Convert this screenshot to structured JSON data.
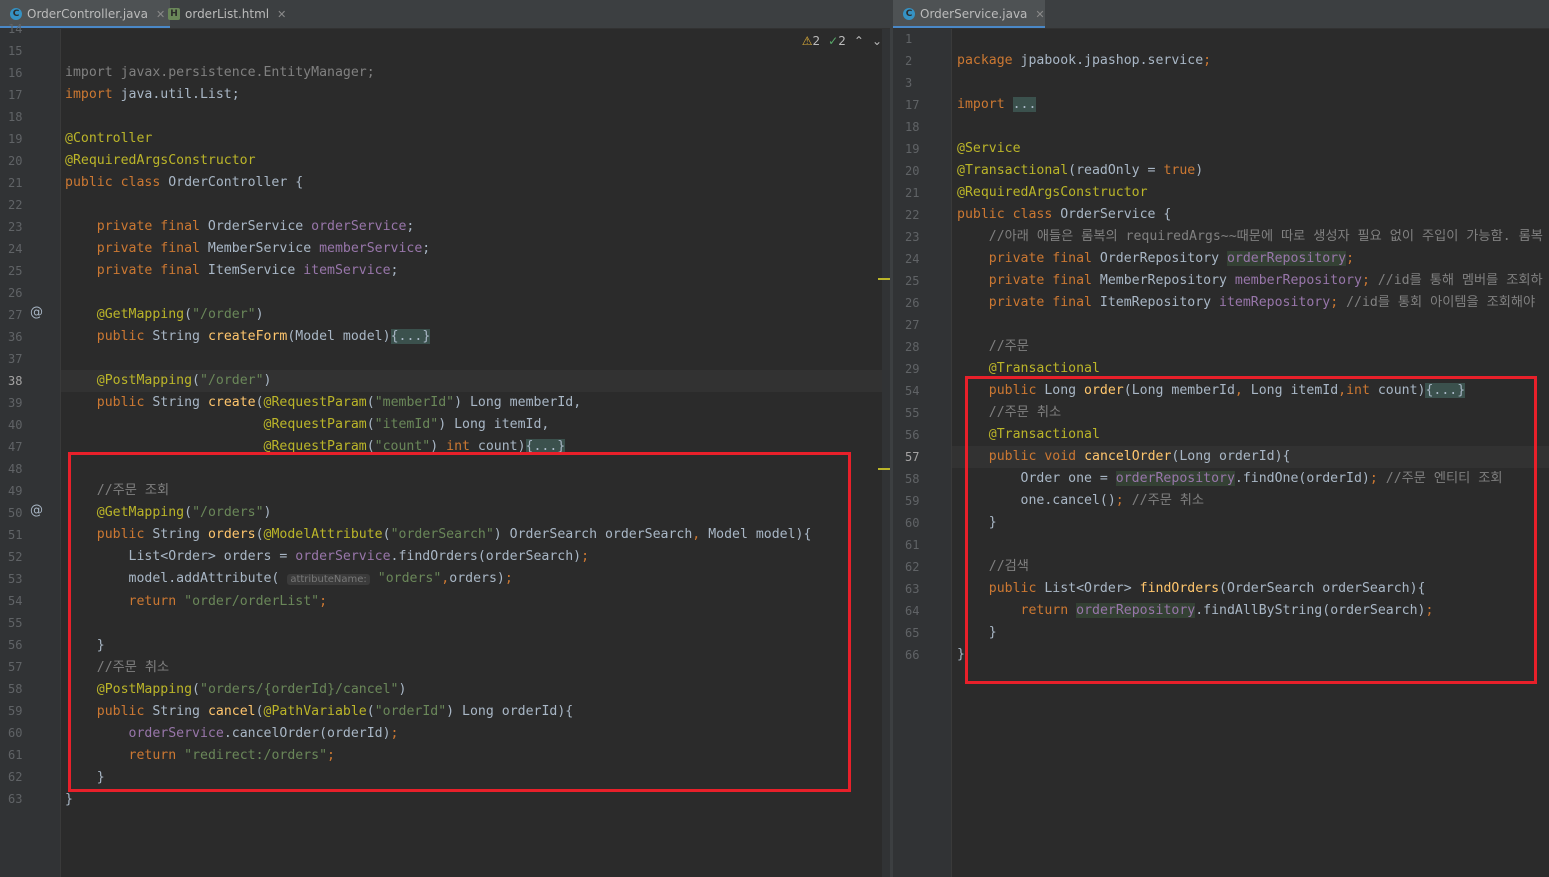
{
  "left_tabs": [
    {
      "label": "OrderController.java",
      "icon": "java-class-icon",
      "active": true
    },
    {
      "label": "orderList.html",
      "icon": "html-file-icon",
      "active": false
    }
  ],
  "right_tabs": [
    {
      "label": "OrderService.java",
      "icon": "java-class-icon",
      "active": true
    }
  ],
  "inspection": {
    "warnings": "2",
    "weak_warnings": "2"
  },
  "left_lines": [
    "14",
    "15",
    "16",
    "17",
    "18",
    "19",
    "20",
    "21",
    "22",
    "23",
    "24",
    "25",
    "26",
    "27",
    "36",
    "37",
    "38",
    "39",
    "40",
    "47",
    "48",
    "49",
    "50",
    "51",
    "52",
    "53",
    "54",
    "55",
    "56",
    "57",
    "58",
    "59",
    "60",
    "61",
    "62",
    "63"
  ],
  "left_current_line": "38",
  "right_lines": [
    "1",
    "2",
    "3",
    "17",
    "18",
    "19",
    "20",
    "21",
    "22",
    "23",
    "24",
    "25",
    "26",
    "27",
    "28",
    "29",
    "54",
    "55",
    "56",
    "57",
    "58",
    "59",
    "60",
    "61",
    "62",
    "63",
    "64",
    "65",
    "66"
  ],
  "right_current_line": "57",
  "inlay_hint": "attributeName:",
  "fold_placeholder": "{...}",
  "import_placeholder": "...",
  "colors": {
    "highlight_box": "#e8202a",
    "keyword": "#cc7832",
    "string": "#6a8759",
    "annotation": "#bbb529",
    "field": "#9876aa",
    "method": "#ffc66d"
  }
}
